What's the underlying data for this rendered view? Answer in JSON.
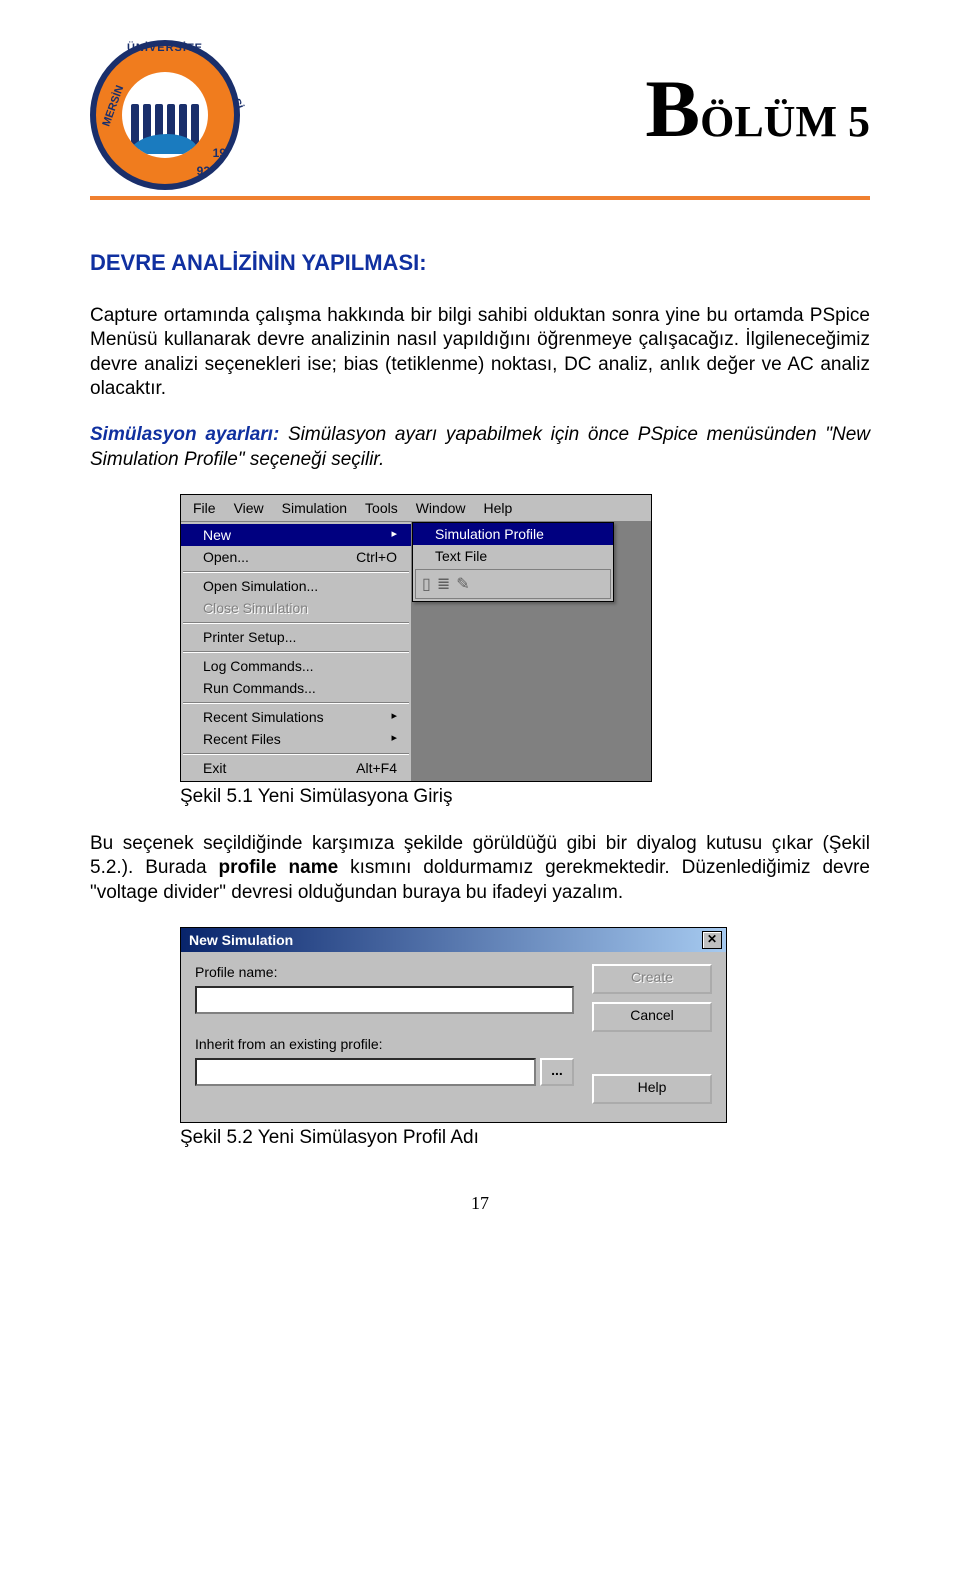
{
  "logo": {
    "arc_top": "ÜNİVERSİTE",
    "arc_left": "MERSİN",
    "arc_right": "Sİ",
    "year_a": "19",
    "year_b": "92"
  },
  "chapter": {
    "big": "B",
    "rest": "ÖLÜM 5"
  },
  "heading": "DEVRE ANALİZİNİN YAPILMASI:",
  "para1": "Capture ortamında çalışma hakkında bir bilgi sahibi olduktan sonra yine bu ortamda PSpice Menüsü kullanarak devre analizinin nasıl yapıldığını öğrenmeye çalışacağız. İlgileneceğimiz devre analizi seçenekleri ise;  bias (tetiklenme) noktası, DC analiz, anlık değer ve AC analiz olacaktır.",
  "para2_lead": "Simülasyon ayarları:",
  "para2_rest": " Simülasyon ayarı yapabilmek için önce PSpice menüsünden \"New Simulation Profile\" seçeneği seçilir.",
  "menubar": [
    "File",
    "View",
    "Simulation",
    "Tools",
    "Window",
    "Help"
  ],
  "file_menu": {
    "new": {
      "label": "New",
      "sel": true
    },
    "open": {
      "label": "Open...",
      "accel": "Ctrl+O"
    },
    "open_sim": "Open Simulation...",
    "close_sim": "Close Simulation",
    "printer": "Printer Setup...",
    "log": "Log Commands...",
    "run": "Run Commands...",
    "recent_sim": "Recent Simulations",
    "recent_files": "Recent Files",
    "exit": {
      "label": "Exit",
      "accel": "Alt+F4"
    }
  },
  "submenu": {
    "sim_profile": "Simulation Profile",
    "text_file": "Text File"
  },
  "caption1": "Şekil 5.1 Yeni Simülasyona Giriş",
  "para3_a": "Bu seçenek seçildiğinde karşımıza şekilde görüldüğü gibi bir diyalog kutusu çıkar (Şekil 5.2.). Burada ",
  "para3_bold": "profile name",
  "para3_b": " kısmını doldurmamız gerekmektedir. Düzenlediğimiz devre \"voltage divider\" devresi olduğundan buraya bu ifadeyi yazalım.",
  "dialog": {
    "title": "New Simulation",
    "profile_label": "Profile name:",
    "inherit_label": "Inherit from an existing profile:",
    "create": "Create",
    "cancel": "Cancel",
    "help": "Help",
    "browse": "..."
  },
  "caption2": "Şekil 5.2 Yeni Simülasyon Profil Adı",
  "page_number": "17"
}
